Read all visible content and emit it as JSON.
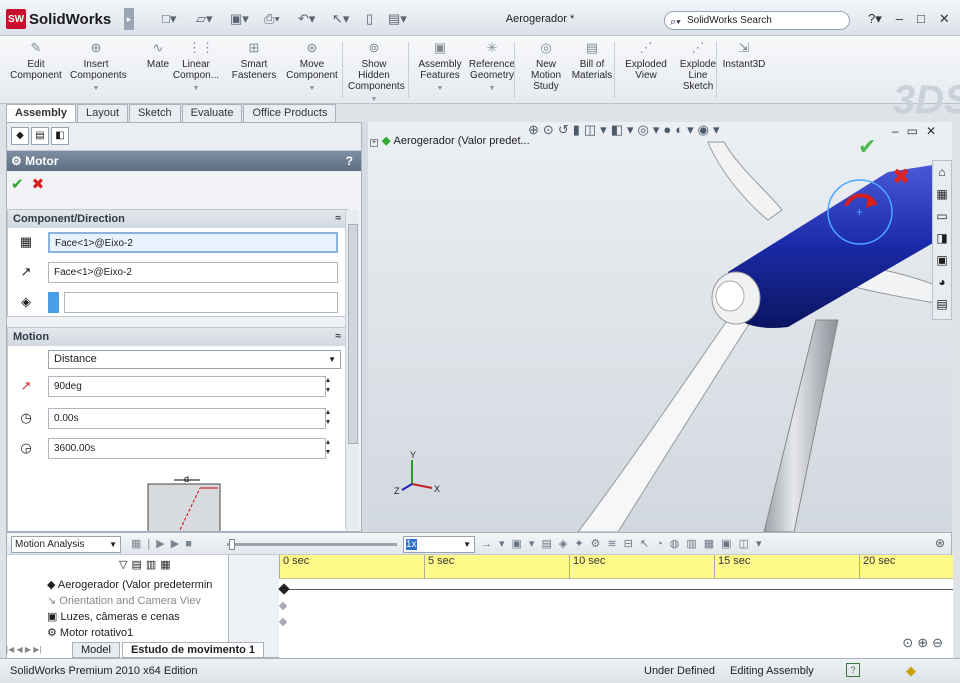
{
  "app": {
    "logo_text": "SolidWorks",
    "doc_title": "Aerogerador *",
    "search_placeholder": "SolidWorks Search"
  },
  "ribbon": [
    {
      "label": "Edit Component",
      "icon": "edit-component-icon"
    },
    {
      "label": "Insert Components",
      "icon": "insert-components-icon"
    },
    {
      "label": "Mate",
      "icon": "mate-icon"
    },
    {
      "label": "Linear Compon...",
      "icon": "linear-pattern-icon"
    },
    {
      "label": "Smart Fasteners",
      "icon": "smart-fasteners-icon"
    },
    {
      "label": "Move Component",
      "icon": "move-component-icon"
    },
    {
      "label": "Show Hidden Components",
      "icon": "show-hidden-icon"
    },
    {
      "label": "Assembly Features",
      "icon": "assembly-features-icon"
    },
    {
      "label": "Reference Geometry",
      "icon": "reference-geometry-icon"
    },
    {
      "label": "New Motion Study",
      "icon": "motion-study-icon"
    },
    {
      "label": "Bill of Materials",
      "icon": "bom-icon"
    },
    {
      "label": "Exploded View",
      "icon": "exploded-view-icon"
    },
    {
      "label": "Explode Line Sketch",
      "icon": "explode-line-icon"
    },
    {
      "label": "Instant3D",
      "icon": "instant3d-icon"
    }
  ],
  "cmd_tabs": [
    "Assembly",
    "Layout",
    "Sketch",
    "Evaluate",
    "Office Products"
  ],
  "pm": {
    "title": "Motor",
    "help": "?",
    "component_direction": {
      "heading": "Component/Direction",
      "face1": "Face<1>@Eixo-2",
      "face2": "Face<1>@Eixo-2",
      "component": ""
    },
    "motion": {
      "heading": "Motion",
      "type": "Distance",
      "displacement": "90deg",
      "start_time": "0.00s",
      "duration": "3600.00s",
      "plot_label": "d"
    }
  },
  "view": {
    "tree_root": "Aerogerador  (Valor predet..."
  },
  "motion_mgr": {
    "study_type": "Motion Analysis",
    "speed": "1x",
    "tree": [
      {
        "label": "Aerogerador  (Valor predetermin",
        "dim": false
      },
      {
        "label": "Orientation and Camera Viev",
        "dim": true
      },
      {
        "label": "Luzes, câmeras e cenas",
        "dim": false
      },
      {
        "label": "Motor rotativo1",
        "dim": false
      }
    ],
    "ticks": [
      "0 sec",
      "5 sec",
      "10 sec",
      "15 sec",
      "20 sec"
    ]
  },
  "bottom_tabs": [
    "Model",
    "Estudo de movimento 1"
  ],
  "status": {
    "edition": "SolidWorks Premium 2010 x64 Edition",
    "state": "Under Defined",
    "mode": "Editing Assembly"
  },
  "colors": {
    "nacelle": "#1a2aa8",
    "ruler": "#fffb8a",
    "ok": "#2aa52a",
    "cancel": "#d42020"
  }
}
